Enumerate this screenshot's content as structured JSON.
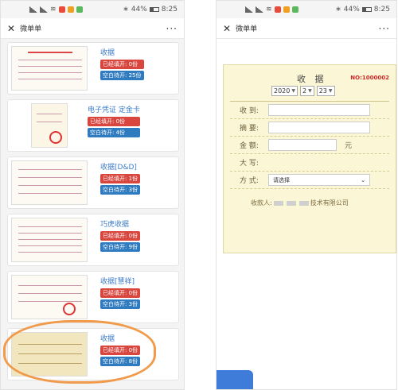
{
  "status": {
    "battery": "44%",
    "time": "8:25"
  },
  "header": {
    "title": "微单单",
    "more": "···"
  },
  "list": {
    "filled_label": "已经填开",
    "empty_label": "空白待开",
    "items": [
      {
        "name": "收据",
        "filled": "0份",
        "empty": "25份"
      },
      {
        "name": "电子凭证 定金卡",
        "filled": "0份",
        "empty": "4份"
      },
      {
        "name": "收据[D&D]",
        "filled": "1份",
        "empty": "3份"
      },
      {
        "name": "巧虎收据",
        "filled": "0份",
        "empty": "9份"
      },
      {
        "name": "收据[慧祥]",
        "filled": "0份",
        "empty": "3份"
      },
      {
        "name": "收据",
        "filled": "0份",
        "empty": "8份"
      }
    ]
  },
  "receipt": {
    "title": "收 据",
    "number": "NO:1000002",
    "year": "2020",
    "month": "2",
    "day": "23",
    "fields": {
      "received": "收 到:",
      "summary": "摘 要:",
      "amount": "金 额:",
      "amount_unit": "元",
      "upper": "大 写:",
      "method": "方 式:",
      "method_placeholder": "请选择"
    },
    "payee_label": "收款人:",
    "payee_name_tail": "技术有限公司"
  }
}
